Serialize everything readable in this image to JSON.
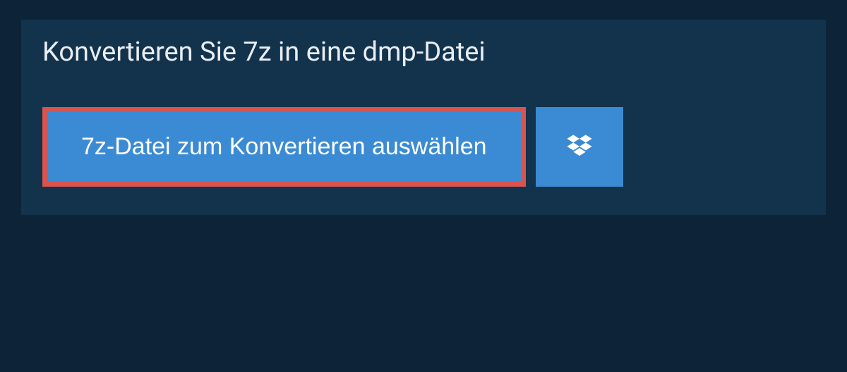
{
  "heading": "Konvertieren Sie 7z in eine dmp-Datei",
  "upload": {
    "file_select_label": "7z-Datei zum Konvertieren auswählen"
  },
  "colors": {
    "background": "#0d2438",
    "panel": "#13334d",
    "button": "#3b8bd4",
    "highlight_border": "#d9534f",
    "text_light": "#e8eef3"
  }
}
